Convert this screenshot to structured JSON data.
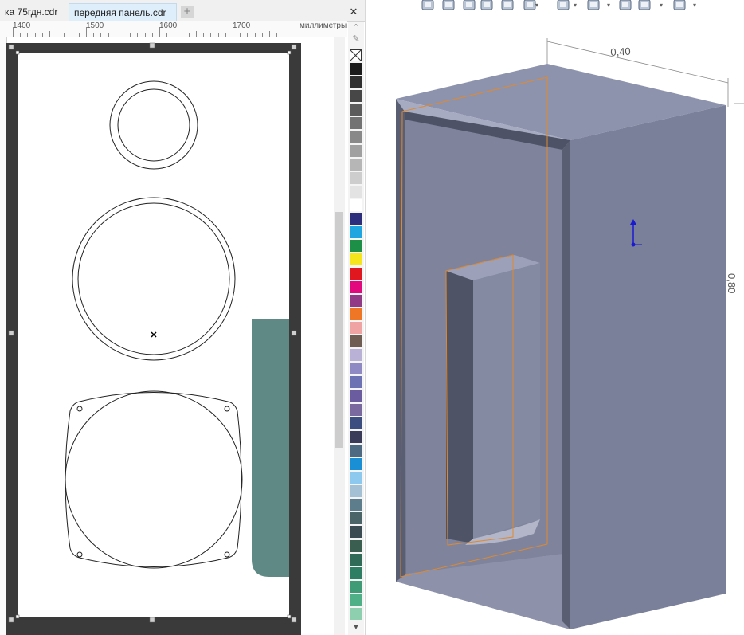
{
  "corel": {
    "tabs": [
      {
        "label": "ка 75гдн.cdr",
        "active": false
      },
      {
        "label": "передняя панель.cdr",
        "active": true
      }
    ],
    "add_tab_icon": "plus-icon",
    "close_icon": "close-icon",
    "ruler": {
      "labels": [
        "1400",
        "1500",
        "1600",
        "1700"
      ],
      "unit": "миллиметры"
    },
    "palette": {
      "swatches": [
        "#1c1c1c",
        "#303030",
        "#474747",
        "#5c5c5c",
        "#737373",
        "#898989",
        "#a0a0a0",
        "#b6b6b6",
        "#cdcdcd",
        "#e3e3e3",
        "#ffffff",
        "#2d2d7d",
        "#1fa6e0",
        "#1e8f47",
        "#f7e51b",
        "#e0171f",
        "#e4087f",
        "#933a86",
        "#ee7625",
        "#efa3a3",
        "#6f5c52",
        "#b9b2d6",
        "#8f8ac4",
        "#6d72b5",
        "#6a5c9f",
        "#7a699f",
        "#3c4e80",
        "#3a3b59",
        "#4e6a83",
        "#1a8fd6",
        "#8dc9ee",
        "#a4c0d4",
        "#5e7d8c",
        "#4a6468",
        "#3b4d52",
        "#3a5e4f",
        "#306b57",
        "#2e7e63",
        "#3f9a76",
        "#4fb088",
        "#8ecfb0"
      ]
    }
  },
  "solidworks": {
    "toolbar_icons": [
      "zoom-to-fit-icon",
      "zoom-area-icon",
      "previous-view-icon",
      "section-view-icon",
      "dynamic-annotation-icon",
      "view-orientation-icon",
      "display-style-icon",
      "hide-show-icon",
      "edit-appearance-icon",
      "apply-scene-icon",
      "view-settings-icon"
    ],
    "dimension_width": "0,40",
    "dimension_height": "0,80"
  }
}
